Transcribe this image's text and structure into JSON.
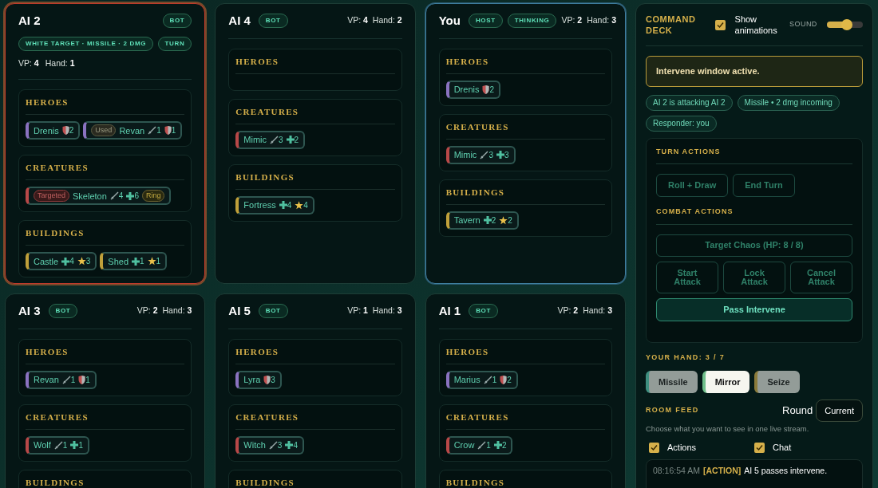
{
  "players": [
    {
      "name": "AI 2",
      "stacked": true,
      "kind": "target",
      "badges": [
        {
          "text": "BOT"
        },
        {
          "text": "WHITE TARGET · MISSILE · 2 DMG"
        },
        {
          "text": "TURN"
        }
      ],
      "vp_label": "VP:",
      "vp": "4",
      "hand_label": "Hand:",
      "hand": "1",
      "sections": [
        {
          "title": "HEROES",
          "cards": [
            {
              "name": "Drenis",
              "kind": "hero",
              "stats": [
                {
                  "kind": "shield",
                  "value": "2"
                }
              ]
            },
            {
              "name": "Revan",
              "kind": "hero",
              "tags": [
                {
                  "text": "Used",
                  "kind": "used"
                }
              ],
              "stats": [
                {
                  "kind": "sword",
                  "value": "1"
                },
                {
                  "kind": "shield",
                  "value": "1"
                }
              ]
            }
          ]
        },
        {
          "title": "CREATURES",
          "cards": [
            {
              "name": "Skeleton",
              "kind": "creature",
              "tags": [
                {
                  "text": "Targeted",
                  "kind": "targeted"
                },
                {
                  "text": "Ring",
                  "kind": "item"
                }
              ],
              "stats": [
                {
                  "kind": "sword",
                  "value": "4"
                },
                {
                  "kind": "plus",
                  "value": "6"
                }
              ]
            }
          ]
        },
        {
          "title": "BUILDINGS",
          "cards": [
            {
              "name": "Castle",
              "kind": "building",
              "stats": [
                {
                  "kind": "plus",
                  "value": "4"
                },
                {
                  "kind": "star",
                  "value": "3"
                }
              ]
            },
            {
              "name": "Shed",
              "kind": "building",
              "stats": [
                {
                  "kind": "plus",
                  "value": "1"
                },
                {
                  "kind": "star",
                  "value": "1"
                }
              ]
            }
          ]
        }
      ]
    },
    {
      "name": "AI 4",
      "stacked": false,
      "kind": "normal",
      "badges": [
        {
          "text": "BOT"
        }
      ],
      "vp_label": "VP:",
      "vp": "4",
      "hand_label": "Hand:",
      "hand": "2",
      "sections": [
        {
          "title": "HEROES"
        },
        {
          "title": "CREATURES",
          "cards": [
            {
              "name": "Mimic",
              "kind": "creature",
              "stats": [
                {
                  "kind": "sword",
                  "value": "3"
                },
                {
                  "kind": "plus",
                  "value": "2"
                }
              ]
            }
          ]
        },
        {
          "title": "BUILDINGS",
          "cards": [
            {
              "name": "Fortress",
              "kind": "building",
              "stats": [
                {
                  "kind": "plus",
                  "value": "4"
                },
                {
                  "kind": "star",
                  "value": "4"
                }
              ]
            }
          ]
        }
      ]
    },
    {
      "name": "You",
      "stacked": false,
      "kind": "self",
      "badges": [
        {
          "text": "HOST"
        },
        {
          "text": "THINKING"
        }
      ],
      "vp_label": "VP:",
      "vp": "2",
      "hand_label": "Hand:",
      "hand": "3",
      "sections": [
        {
          "title": "HEROES",
          "cards": [
            {
              "name": "Drenis",
              "kind": "hero",
              "stats": [
                {
                  "kind": "shield",
                  "value": "2"
                }
              ]
            }
          ]
        },
        {
          "title": "CREATURES",
          "cards": [
            {
              "name": "Mimic",
              "kind": "creature",
              "stats": [
                {
                  "kind": "sword",
                  "value": "3"
                },
                {
                  "kind": "plus",
                  "value": "3"
                }
              ]
            }
          ]
        },
        {
          "title": "BUILDINGS",
          "cards": [
            {
              "name": "Tavern",
              "kind": "building",
              "stats": [
                {
                  "kind": "plus",
                  "value": "2"
                },
                {
                  "kind": "star",
                  "value": "2"
                }
              ]
            }
          ]
        }
      ]
    },
    {
      "name": "AI 3",
      "stacked": false,
      "kind": "normal",
      "badges": [
        {
          "text": "BOT"
        }
      ],
      "vp_label": "VP:",
      "vp": "2",
      "hand_label": "Hand:",
      "hand": "3",
      "sections": [
        {
          "title": "HEROES",
          "cards": [
            {
              "name": "Revan",
              "kind": "hero",
              "stats": [
                {
                  "kind": "sword",
                  "value": "1"
                },
                {
                  "kind": "shield",
                  "value": "1"
                }
              ]
            }
          ]
        },
        {
          "title": "CREATURES",
          "cards": [
            {
              "name": "Wolf",
              "kind": "creature",
              "stats": [
                {
                  "kind": "sword",
                  "value": "1"
                },
                {
                  "kind": "plus",
                  "value": "1"
                }
              ]
            }
          ]
        },
        {
          "title": "BUILDINGS"
        }
      ]
    },
    {
      "name": "AI 5",
      "stacked": false,
      "kind": "normal",
      "badges": [
        {
          "text": "BOT"
        }
      ],
      "vp_label": "VP:",
      "vp": "1",
      "hand_label": "Hand:",
      "hand": "3",
      "sections": [
        {
          "title": "HEROES",
          "cards": [
            {
              "name": "Lyra",
              "kind": "hero",
              "stats": [
                {
                  "kind": "shield",
                  "value": "3"
                }
              ]
            }
          ]
        },
        {
          "title": "CREATURES",
          "cards": [
            {
              "name": "Witch",
              "kind": "creature",
              "stats": [
                {
                  "kind": "sword",
                  "value": "3"
                },
                {
                  "kind": "plus",
                  "value": "4"
                }
              ]
            }
          ]
        },
        {
          "title": "BUILDINGS"
        }
      ]
    },
    {
      "name": "AI 1",
      "stacked": false,
      "kind": "normal",
      "badges": [
        {
          "text": "BOT"
        }
      ],
      "vp_label": "VP:",
      "vp": "2",
      "hand_label": "Hand:",
      "hand": "3",
      "sections": [
        {
          "title": "HEROES",
          "cards": [
            {
              "name": "Marius",
              "kind": "hero",
              "stats": [
                {
                  "kind": "sword",
                  "value": "1"
                },
                {
                  "kind": "shield",
                  "value": "2"
                }
              ]
            }
          ]
        },
        {
          "title": "CREATURES",
          "cards": [
            {
              "name": "Crow",
              "kind": "creature",
              "stats": [
                {
                  "kind": "sword",
                  "value": "1"
                },
                {
                  "kind": "plus",
                  "value": "2"
                }
              ]
            }
          ]
        },
        {
          "title": "BUILDINGS"
        }
      ]
    }
  ],
  "command_deck": {
    "title": "COMMAND DECK",
    "animations": {
      "label": "Show animations",
      "checked": true
    },
    "sound": {
      "label": "SOUND",
      "level": 0.55
    },
    "alert": "Intervene window active.",
    "chips": [
      "AI 2 is attacking AI 2",
      "Missile • 2 dmg incoming",
      "Responder: you"
    ],
    "turn_actions": {
      "title": "TURN ACTIONS",
      "buttons": [
        {
          "label": "Roll + Draw",
          "disabled": true
        },
        {
          "label": "End Turn",
          "disabled": true
        }
      ]
    },
    "combat_actions": {
      "title": "COMBAT ACTIONS",
      "target": {
        "label": "Target Chaos (HP: 8 / 8)",
        "disabled": true
      },
      "buttons": [
        {
          "label": "Start Attack",
          "disabled": true
        },
        {
          "label": "Lock Attack",
          "disabled": true
        },
        {
          "label": "Cancel Attack",
          "disabled": true
        }
      ],
      "pass": {
        "label": "Pass Intervene",
        "disabled": false
      }
    }
  },
  "hand": {
    "title": "YOUR HAND: 3 / 7",
    "cards": [
      {
        "name": "Missile",
        "selected": false,
        "color": "#3f8f80"
      },
      {
        "name": "Mirror",
        "selected": true,
        "color": "#6fbf8a"
      },
      {
        "name": "Seize",
        "selected": false,
        "color": "#8a7a3a"
      }
    ]
  },
  "room_feed": {
    "title": "ROOM FEED",
    "round_label": "Round",
    "round_value": "Current",
    "hint": "Choose what you want to see in one live stream.",
    "filters": [
      {
        "label": "Actions",
        "checked": true
      },
      {
        "label": "Chat",
        "checked": true
      }
    ],
    "log": [
      {
        "time": "08:16:54 AM",
        "tag": "[ACTION]",
        "text": "AI 5 passes intervene."
      }
    ]
  }
}
